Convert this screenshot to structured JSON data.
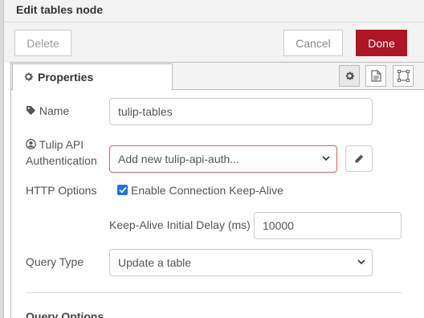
{
  "dialog": {
    "title": "Edit tables node",
    "delete_label": "Delete",
    "cancel_label": "Cancel",
    "done_label": "Done"
  },
  "tabs": {
    "properties_label": "Properties"
  },
  "form": {
    "name_label": "Name",
    "name_value": "tulip-tables",
    "auth_label_line1": "Tulip API",
    "auth_label_line2": "Authentication",
    "auth_value": "Add new tulip-api-auth...",
    "http_options_label": "HTTP Options",
    "keepalive_checkbox_label": "Enable Connection Keep-Alive",
    "keepalive_checked": true,
    "keepalive_delay_label": "Keep-Alive Initial Delay (ms)",
    "keepalive_delay_value": "10000",
    "query_type_label": "Query Type",
    "query_type_value": "Update a table",
    "query_options_heading": "Query Options"
  },
  "colors": {
    "done_button": "#ad1625",
    "invalid_border": "#d6615f",
    "checkbox": "#1a73e8"
  }
}
